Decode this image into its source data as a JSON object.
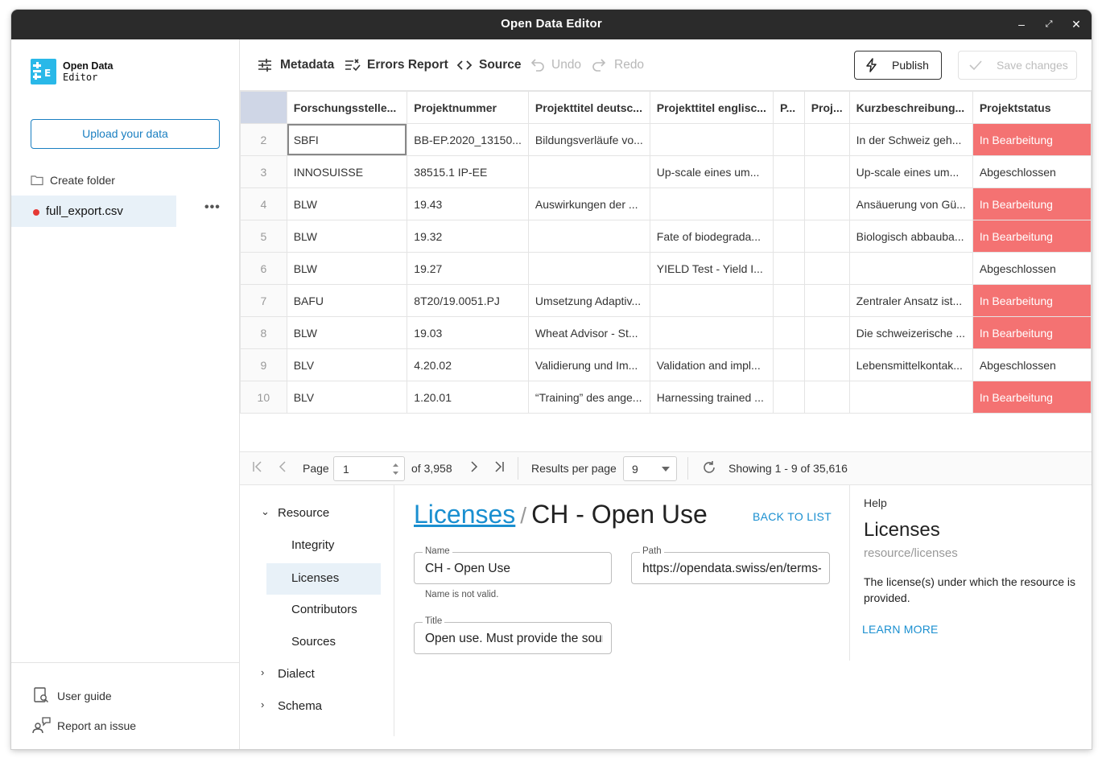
{
  "window": {
    "title": "Open Data Editor"
  },
  "sidebar": {
    "logo_line1": "Open Data",
    "logo_line2": "Editor",
    "upload_label": "Upload your data",
    "create_folder_label": "Create folder",
    "file_name": "full_export.csv",
    "more_label": "•••",
    "user_guide_label": "User guide",
    "report_issue_label": "Report an issue"
  },
  "toolbar": {
    "metadata_label": "Metadata",
    "errors_label": "Errors Report",
    "source_label": "Source",
    "undo_label": "Undo",
    "redo_label": "Redo",
    "publish_label": "Publish",
    "save_label": "Save changes"
  },
  "grid": {
    "columns": [
      "Forschungsstelle...",
      "Projektnummer",
      "Projekttitel deutsc...",
      "Projekttitel englisc...",
      "P...",
      "Proj...",
      "Kurzbeschreibung...",
      "Projektstatus"
    ],
    "rows": [
      {
        "n": "2",
        "cells": [
          "SBFI",
          "BB-EP.2020_13150...",
          "Bildungsverläufe vo...",
          "",
          "",
          "",
          "In der Schweiz geh...",
          "In Bearbeitung"
        ]
      },
      {
        "n": "3",
        "cells": [
          "INNOSUISSE",
          "38515.1 IP-EE",
          "",
          "Up-scale eines um...",
          "",
          "",
          "Up-scale eines um...",
          "Abgeschlossen"
        ]
      },
      {
        "n": "4",
        "cells": [
          "BLW",
          "19.43",
          "Auswirkungen der ...",
          "",
          "",
          "",
          "Ansäuerung von Gü...",
          "In Bearbeitung"
        ]
      },
      {
        "n": "5",
        "cells": [
          "BLW",
          "19.32",
          "",
          "Fate of biodegrada...",
          "",
          "",
          "Biologisch abbauba...",
          "In Bearbeitung"
        ]
      },
      {
        "n": "6",
        "cells": [
          "BLW",
          "19.27",
          "",
          "YIELD Test - Yield I...",
          "",
          "",
          "",
          "Abgeschlossen"
        ]
      },
      {
        "n": "7",
        "cells": [
          "BAFU",
          "8T20/19.0051.PJ",
          "Umsetzung Adaptiv...",
          "",
          "",
          "",
          "Zentraler Ansatz ist...",
          "In Bearbeitung"
        ]
      },
      {
        "n": "8",
        "cells": [
          "BLW",
          "19.03",
          "Wheat Advisor - St...",
          "",
          "",
          "",
          "Die schweizerische ...",
          "In Bearbeitung"
        ]
      },
      {
        "n": "9",
        "cells": [
          "BLV",
          "4.20.02",
          "Validierung und Im...",
          "Validation and impl...",
          "",
          "",
          "Lebensmittelkontak...",
          "Abgeschlossen"
        ]
      },
      {
        "n": "10",
        "cells": [
          "BLV",
          "1.20.01",
          "“Training” des ange...",
          "Harnessing trained ...",
          "",
          "",
          "",
          "In Bearbeitung"
        ]
      }
    ],
    "error_status_value": "In Bearbeitung",
    "error_color": "#f47272"
  },
  "pager": {
    "page_label": "Page",
    "page_value": "1",
    "of_label": "of 3,958",
    "results_label": "Results per page",
    "per_page_value": "9",
    "showing_label": "Showing 1 - 9 of 35,616"
  },
  "meta_nav": {
    "resource": "Resource",
    "integrity": "Integrity",
    "licenses": "Licenses",
    "contributors": "Contributors",
    "sources": "Sources",
    "dialect": "Dialect",
    "schema": "Schema"
  },
  "form": {
    "crumb_link": "Licenses",
    "crumb_sep": "/",
    "crumb_current": "CH - Open Use",
    "back_label": "BACK TO LIST",
    "name_label": "Name",
    "name_value": "CH - Open Use",
    "name_error": "Name is not valid.",
    "path_label": "Path",
    "path_value": "https://opendata.swiss/en/terms-of-use",
    "title_label": "Title",
    "title_value": "Open use. Must provide the source."
  },
  "help": {
    "heading": "Help",
    "title": "Licenses",
    "path": "resource/licenses",
    "description": "The license(s) under which the resource is provided.",
    "learn_more": "LEARN MORE"
  },
  "colors": {
    "accent": "#1a8fd0",
    "error": "#f47272",
    "active_bg": "#e8f1f8",
    "titlebar": "#2b2b2b"
  }
}
